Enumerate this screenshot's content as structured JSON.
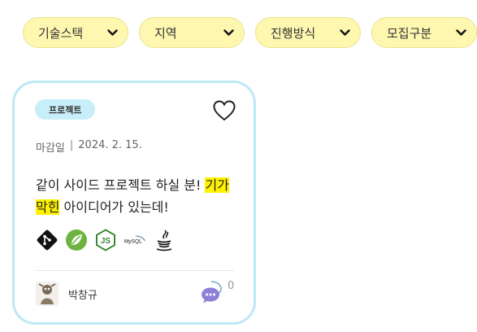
{
  "filters": [
    {
      "label": "기술스택",
      "icon": "chevron-down-icon"
    },
    {
      "label": "지역",
      "icon": "chevron-down-icon"
    },
    {
      "label": "진행방식",
      "icon": "chevron-down-icon"
    },
    {
      "label": "모집구분",
      "icon": "chevron-down-icon"
    }
  ],
  "card": {
    "badge": "프로젝트",
    "deadline_label": "마감일",
    "deadline_sep": "|",
    "deadline_date": "2024. 2. 15.",
    "title_part1": "같이 사이드 프로젝트 하실 분! ",
    "title_highlight": "기가막힌",
    "title_part2": " 아이디어가 있는데!",
    "tech_stack": [
      "git-icon",
      "spring-icon",
      "nodejs-icon",
      "mysql-icon",
      "java-icon"
    ],
    "author": "박창규",
    "comment_count": "0"
  },
  "colors": {
    "filter_bg": "#fdf7b0",
    "card_border": "#bde8f6",
    "badge_bg": "#c8eefa",
    "highlight": "#fff200"
  }
}
